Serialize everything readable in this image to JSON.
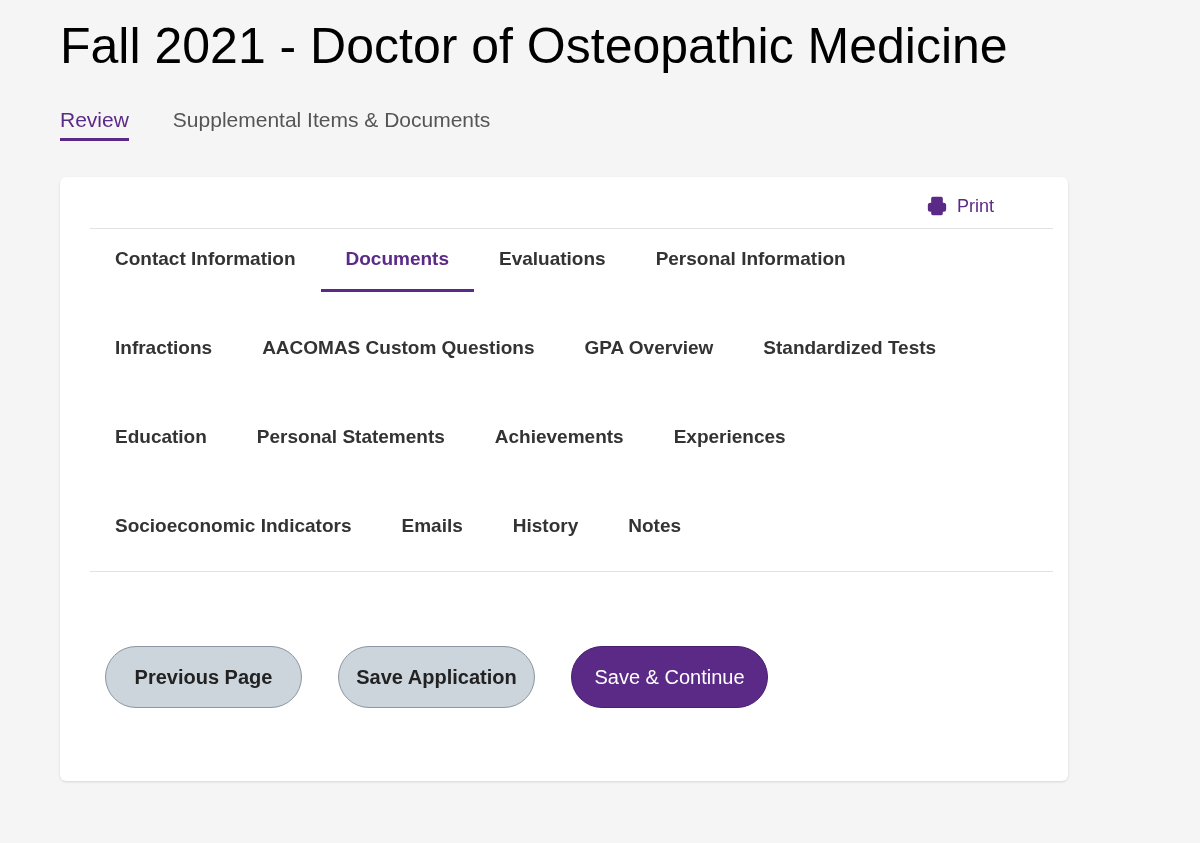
{
  "title": "Fall 2021 - Doctor of Osteopathic Medicine",
  "page_tabs": [
    {
      "label": "Review",
      "selected": true
    },
    {
      "label": "Supplemental Items & Documents",
      "selected": false
    }
  ],
  "print_link": "Print",
  "section_tab_rows": [
    [
      {
        "label": "Contact Information",
        "selected": false
      },
      {
        "label": "Documents",
        "selected": true
      },
      {
        "label": "Evaluations",
        "selected": false
      },
      {
        "label": "Personal Information",
        "selected": false
      }
    ],
    [
      {
        "label": "Infractions",
        "selected": false
      },
      {
        "label": "AACOMAS Custom Questions",
        "selected": false
      },
      {
        "label": "GPA Overview",
        "selected": false
      },
      {
        "label": "Standardized Tests",
        "selected": false
      }
    ],
    [
      {
        "label": "Education",
        "selected": false
      },
      {
        "label": "Personal Statements",
        "selected": false
      },
      {
        "label": "Achievements",
        "selected": false
      },
      {
        "label": "Experiences",
        "selected": false
      }
    ],
    [
      {
        "label": "Socioeconomic Indicators",
        "selected": false
      },
      {
        "label": "Emails",
        "selected": false
      },
      {
        "label": "History",
        "selected": false
      },
      {
        "label": "Notes",
        "selected": false
      }
    ]
  ],
  "buttons": [
    {
      "label": "Previous Page",
      "kind": "secondary"
    },
    {
      "label": "Save Application",
      "kind": "secondary"
    },
    {
      "label": "Save & Continue",
      "kind": "primary"
    }
  ]
}
